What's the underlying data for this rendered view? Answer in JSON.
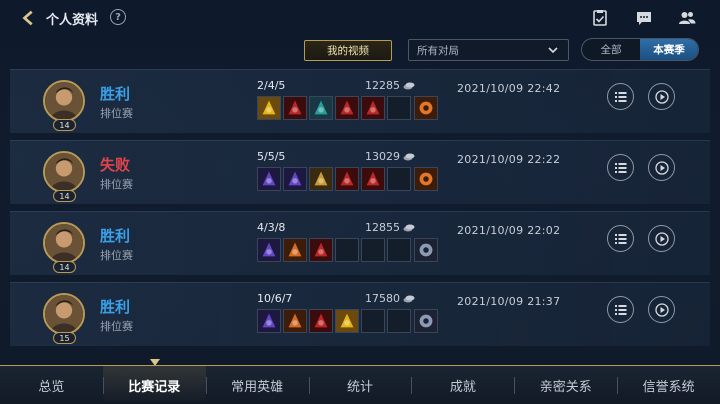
{
  "header": {
    "title": "个人资料",
    "help_glyph": "?",
    "icons": [
      "checklist-icon",
      "chat-icon",
      "friends-icon"
    ]
  },
  "filters": {
    "my_videos_label": "我的视频",
    "mode_selected": "所有对局",
    "season_options": [
      "全部",
      "本赛季"
    ],
    "season_selected": "本赛季"
  },
  "matches": [
    {
      "result": "胜利",
      "result_type": "win",
      "queue": "排位赛",
      "level": "14",
      "kda": "2/4/5",
      "gold": "12285",
      "datetime": "2021/10/09 22:42",
      "items": [
        "yellow",
        "red",
        "teal",
        "red",
        "red",
        "empty"
      ],
      "trinket": "orange"
    },
    {
      "result": "失败",
      "result_type": "lose",
      "queue": "排位赛",
      "level": "14",
      "kda": "5/5/5",
      "gold": "13029",
      "datetime": "2021/10/09 22:22",
      "items": [
        "purple",
        "purple",
        "gold",
        "red",
        "red",
        "empty"
      ],
      "trinket": "orange"
    },
    {
      "result": "胜利",
      "result_type": "win",
      "queue": "排位赛",
      "level": "14",
      "kda": "4/3/8",
      "gold": "12855",
      "datetime": "2021/10/09 22:02",
      "items": [
        "purple",
        "orange",
        "red",
        "empty",
        "empty",
        "empty"
      ],
      "trinket": "slate"
    },
    {
      "result": "胜利",
      "result_type": "win",
      "queue": "排位赛",
      "level": "15",
      "kda": "10/6/7",
      "gold": "17580",
      "datetime": "2021/10/09 21:37",
      "items": [
        "purple",
        "orange",
        "red",
        "yellow",
        "empty",
        "empty"
      ],
      "trinket": "slate"
    }
  ],
  "bottom_nav": {
    "items": [
      "总览",
      "比赛记录",
      "常用英雄",
      "统计",
      "成就",
      "亲密关系",
      "信誉系统"
    ],
    "active": "比赛记录"
  },
  "colors": {
    "win": "#3aa0e8",
    "lose": "#e2434b",
    "gold_accent": "#b89a55",
    "active_tab": "#1c4f80"
  }
}
